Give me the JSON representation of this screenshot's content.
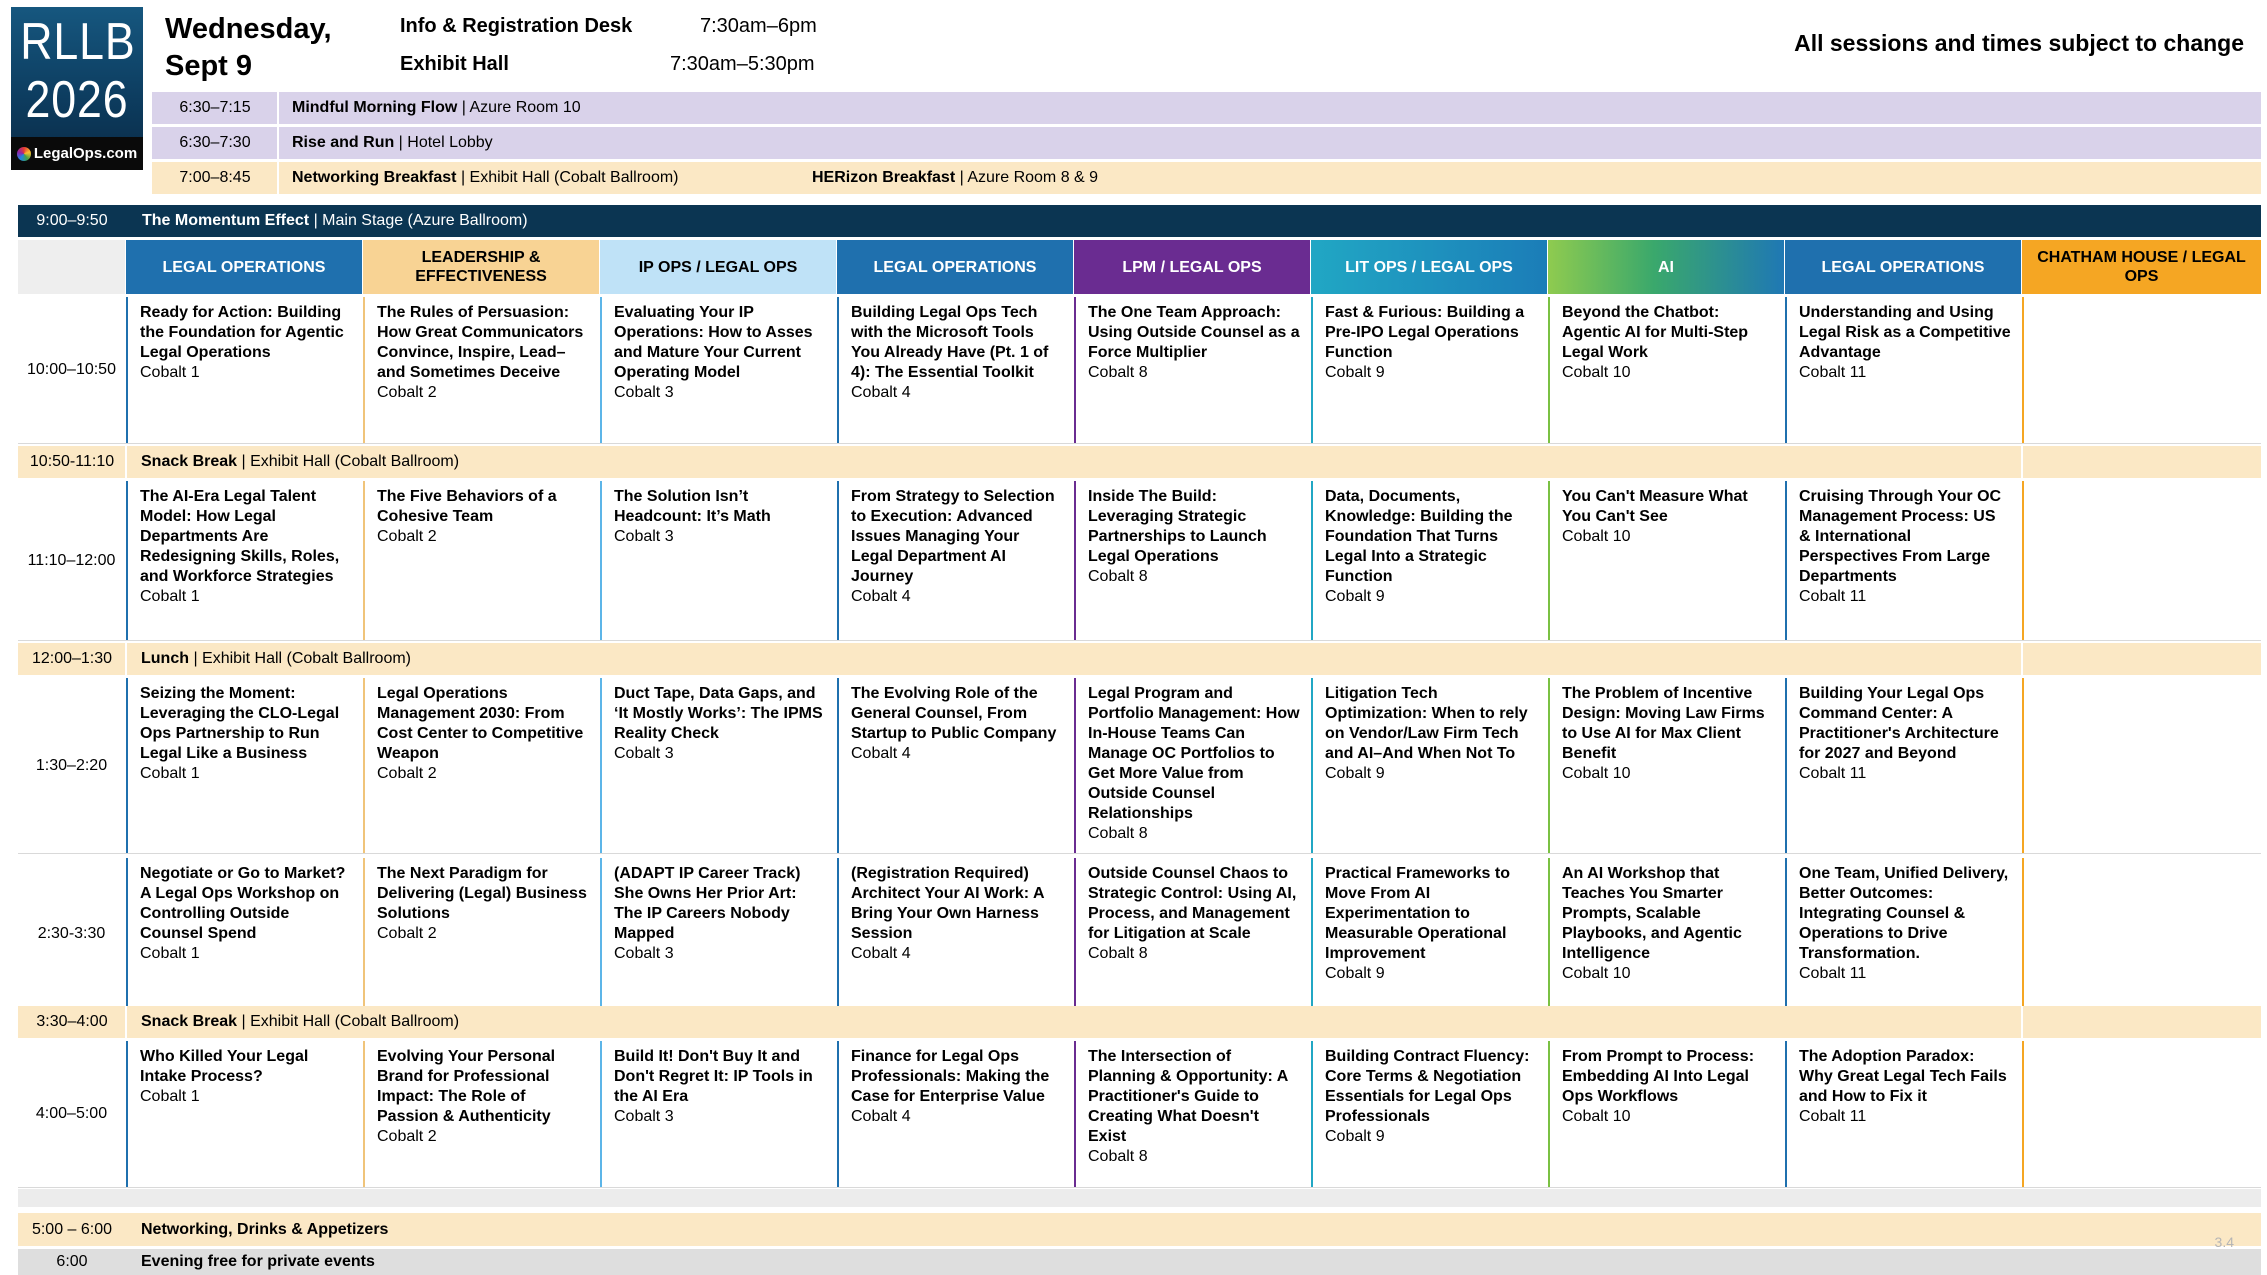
{
  "logo": {
    "line1": "RLLB",
    "line2": "2026",
    "brand": "LegalOps.com"
  },
  "day": {
    "line1": "Wednesday,",
    "line2": "Sept 9"
  },
  "info": [
    {
      "label": "Info & Registration Desk",
      "time": "7:30am–6pm"
    },
    {
      "label": "Exhibit Hall",
      "time": "7:30am–5:30pm"
    }
  ],
  "disclaimer": "All sessions and times subject to change",
  "early": [
    {
      "time": "6:30–7:15",
      "title": "Mindful Morning Flow",
      "location": " | Azure Room 10"
    },
    {
      "time": "6:30–7:30",
      "title": "Rise and Run",
      "location": " | Hotel Lobby"
    },
    {
      "time": "7:00–8:45",
      "title": "Networking Breakfast",
      "location": " | Exhibit Hall (Cobalt Ballroom)",
      "title2": "HERizon Breakfast",
      "location2": " | Azure Room 8 & 9"
    }
  ],
  "keynote": {
    "time": "9:00–9:50",
    "title": "The Momentum Effect",
    "location": " | Main Stage (Azure Ballroom)"
  },
  "tracks": [
    {
      "label": "LEGAL OPERATIONS",
      "bg": "#1f70ae",
      "fg": "#ffffff",
      "accent": "#1f70ae"
    },
    {
      "label": "LEADERSHIP & EFFECTIVENESS",
      "bg": "#f8d394",
      "fg": "#000000",
      "accent": "#f0c47a"
    },
    {
      "label": "IP OPS / LEGAL OPS",
      "bg": "#bfe2f7",
      "fg": "#000000",
      "accent": "#5cb5e8"
    },
    {
      "label": "LEGAL OPERATIONS",
      "bg": "#1f70ae",
      "fg": "#ffffff",
      "accent": "#1f70ae"
    },
    {
      "label": "LPM / LEGAL OPS",
      "bg": "#6a2c91",
      "fg": "#ffffff",
      "accent": "#6a2c91"
    },
    {
      "label": "LIT OPS / LEGAL OPS",
      "bg": "linear-gradient(90deg,#21a7c4,#1b7db8)",
      "fg": "#ffffff",
      "accent": "#21a7c4"
    },
    {
      "label": "AI",
      "bg": "linear-gradient(90deg,#8fcb4f,#3aa86c 45%,#1f78b4)",
      "fg": "#ffffff",
      "accent": "#7ac143"
    },
    {
      "label": "LEGAL OPERATIONS",
      "bg": "#1f70ae",
      "fg": "#ffffff",
      "accent": "#1f70ae"
    },
    {
      "label": "CHATHAM HOUSE / LEGAL OPS",
      "bg": "#f5a623",
      "fg": "#000000",
      "accent": "#f5a623"
    }
  ],
  "breaks": [
    {
      "time": "10:50-11:10",
      "title": "Snack Break",
      "location": " | Exhibit Hall (Cobalt Ballroom)"
    },
    {
      "time": "12:00–1:30",
      "title": "Lunch",
      "location": " | Exhibit Hall (Cobalt Ballroom)"
    },
    {
      "time": "3:30–4:00",
      "title": "Snack Break",
      "location": " | Exhibit Hall (Cobalt Ballroom)"
    }
  ],
  "slots": [
    {
      "time": "10:00–10:50",
      "sessions": [
        {
          "title": "Ready for Action: Building the Foundation for Agentic Legal Operations",
          "room": "Cobalt 1"
        },
        {
          "title": "The Rules of Persuasion: How Great Communicators Convince, Inspire, Lead–and Sometimes Deceive",
          "room": "Cobalt 2"
        },
        {
          "title": "Evaluating Your IP Operations: How to Asses and Mature Your Current Operating Model",
          "room": "Cobalt 3"
        },
        {
          "title": "Building Legal Ops Tech with the Microsoft Tools You Already Have (Pt. 1 of 4): The Essential Toolkit",
          "room": "Cobalt 4"
        },
        {
          "title": "The One Team Approach: Using Outside Counsel as a Force Multiplier",
          "room": "Cobalt 8"
        },
        {
          "title": "Fast & Furious: Building a Pre-IPO Legal Operations Function",
          "room": "Cobalt 9"
        },
        {
          "title": "Beyond the Chatbot: Agentic AI for Multi-Step Legal Work",
          "room": "Cobalt 10"
        },
        {
          "title": "Understanding and Using Legal Risk as a Competitive Advantage",
          "room": "Cobalt 11"
        },
        {
          "title": "",
          "room": ""
        }
      ]
    },
    {
      "time": "11:10–12:00",
      "sessions": [
        {
          "title": "The AI-Era Legal Talent Model: How Legal Departments Are Redesigning Skills, Roles, and Workforce Strategies",
          "room": "Cobalt 1"
        },
        {
          "title": "The Five Behaviors of a Cohesive Team",
          "room": "Cobalt 2"
        },
        {
          "title": "The Solution Isn’t Headcount: It’s Math",
          "room": "Cobalt 3"
        },
        {
          "title": "From Strategy to Selection to Execution: Advanced Issues Managing Your Legal Department AI Journey",
          "room": "Cobalt 4"
        },
        {
          "title": "Inside The Build: Leveraging Strategic Partnerships to Launch Legal Operations",
          "room": "Cobalt 8"
        },
        {
          "title": "Data, Documents, Knowledge: Building the Foundation That Turns Legal Into a Strategic Function",
          "room": "Cobalt 9"
        },
        {
          "title": "You Can't Measure What You Can't See",
          "room": "Cobalt 10"
        },
        {
          "title": "Cruising Through Your OC Management Process: US & International Perspectives From Large Departments",
          "room": "Cobalt 11"
        },
        {
          "title": "",
          "room": ""
        }
      ]
    },
    {
      "time": "1:30–2:20",
      "sessions": [
        {
          "title": "Seizing the Moment: Leveraging the CLO-Legal Ops Partnership to Run Legal Like a Business",
          "room": "Cobalt 1"
        },
        {
          "title": "Legal Operations Management 2030: From Cost Center to Competitive Weapon",
          "room": "Cobalt 2"
        },
        {
          "title": "Duct Tape, Data Gaps, and ‘It Mostly Works’: The IPMS Reality Check",
          "room": "Cobalt 3"
        },
        {
          "title": "The Evolving Role of the General Counsel, From Startup to Public Company",
          "room": "Cobalt 4"
        },
        {
          "title": "Legal Program and Portfolio Management: How In-House Teams Can Manage OC Portfolios to Get More Value from Outside Counsel Relationships",
          "room": "Cobalt 8"
        },
        {
          "title": "Litigation Tech Optimization: When to rely on Vendor/Law Firm Tech and AI–And When Not To",
          "room": "Cobalt 9"
        },
        {
          "title": "The Problem of Incentive Design: Moving Law Firms to Use AI for Max Client Benefit",
          "room": "Cobalt 10"
        },
        {
          "title": "Building Your Legal Ops Command Center: A Practitioner's Architecture for 2027 and Beyond",
          "room": "Cobalt 11"
        },
        {
          "title": "",
          "room": ""
        }
      ]
    },
    {
      "time": "2:30-3:30",
      "sessions": [
        {
          "title": "Negotiate or Go to Market? A Legal Ops Workshop on Controlling Outside Counsel Spend",
          "room": "Cobalt 1"
        },
        {
          "title": "The Next Paradigm for Delivering (Legal) Business Solutions",
          "room": "Cobalt 2"
        },
        {
          "title": "(ADAPT IP Career Track) She Owns Her Prior Art: The IP Careers Nobody Mapped",
          "room": "Cobalt 3"
        },
        {
          "title": "(Registration Required) Architect Your AI Work: A Bring Your Own Harness Session",
          "room": "Cobalt 4"
        },
        {
          "title": "Outside Counsel Chaos to Strategic Control: Using AI, Process, and Management for Litigation at Scale",
          "room": "Cobalt 8"
        },
        {
          "title": "Practical Frameworks to Move From AI Experimentation to Measurable Operational Improvement",
          "room": "Cobalt 9"
        },
        {
          "title": "An AI Workshop that Teaches You Smarter Prompts, Scalable Playbooks, and Agentic Intelligence",
          "room": "Cobalt 10"
        },
        {
          "title": "One Team, Unified Delivery, Better Outcomes: Integrating Counsel & Operations to Drive Transformation.",
          "room": "Cobalt 11"
        },
        {
          "title": "",
          "room": ""
        }
      ]
    },
    {
      "time": "4:00–5:00",
      "sessions": [
        {
          "title": "Who Killed Your Legal Intake Process?",
          "room": "Cobalt 1"
        },
        {
          "title": "Evolving Your Personal Brand for Professional Impact: The Role of Passion & Authenticity",
          "room": "Cobalt 2"
        },
        {
          "title": "Build It! Don't Buy It and Don't Regret It: IP Tools in the AI Era",
          "room": "Cobalt 3"
        },
        {
          "title": "Finance for Legal Ops Professionals: Making the Case for Enterprise Value",
          "room": "Cobalt 4"
        },
        {
          "title": "The Intersection of Planning & Opportunity: A Practitioner's Guide to Creating What Doesn't Exist",
          "room": "Cobalt 8"
        },
        {
          "title": "Building Contract Fluency: Core Terms & Negotiation Essentials for Legal Ops Professionals",
          "room": "Cobalt 9"
        },
        {
          "title": "From Prompt to Process: Embedding AI Into Legal Ops Workflows",
          "room": "Cobalt 10"
        },
        {
          "title": "The Adoption Paradox: Why Great Legal Tech Fails and How to Fix it",
          "room": "Cobalt 11"
        },
        {
          "title": "",
          "room": ""
        }
      ]
    }
  ],
  "evening": [
    {
      "time": "5:00 – 6:00",
      "title": "Networking, Drinks & Appetizers",
      "bg": "#fbe8c5"
    },
    {
      "time": "6:00",
      "title": "Evening free for private events",
      "bg": "#dedede"
    }
  ],
  "page_number": "3.4"
}
